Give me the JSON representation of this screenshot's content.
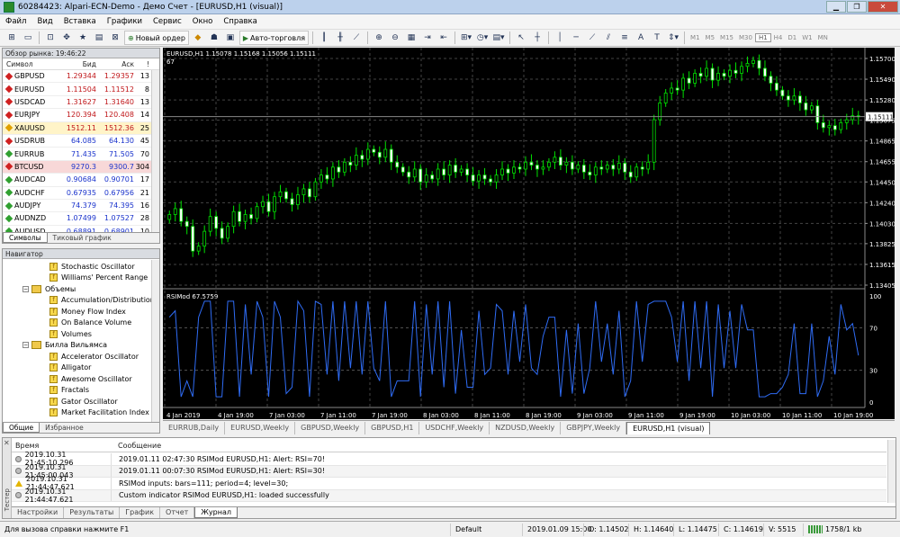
{
  "window": {
    "title": "60284423: Alpari-ECN-Demo - Демо Счет - [EURUSD,H1 (visual)]"
  },
  "menu": [
    "Файл",
    "Вид",
    "Вставка",
    "Графики",
    "Сервис",
    "Окно",
    "Справка"
  ],
  "toolbar": {
    "new_order": "Новый ордер",
    "autotrading": "Авто-торговля",
    "timeframes": [
      "M1",
      "M5",
      "M15",
      "M30",
      "H1",
      "H4",
      "D1",
      "W1",
      "MN"
    ],
    "current_tf": "H1"
  },
  "market_watch": {
    "title": "Обзор рынка: 19:46:22",
    "columns": {
      "symbol": "Символ",
      "bid": "Бид",
      "ask": "Аск",
      "spread": "!"
    },
    "rows": [
      {
        "symbol": "GBPUSD",
        "bid": "1.29344",
        "ask": "1.29357",
        "spread": "13",
        "dir": "down",
        "icon_color": "#d02020"
      },
      {
        "symbol": "EURUSD",
        "bid": "1.11504",
        "ask": "1.11512",
        "spread": "8",
        "dir": "down",
        "icon_color": "#d02020"
      },
      {
        "symbol": "USDCAD",
        "bid": "1.31627",
        "ask": "1.31640",
        "spread": "13",
        "dir": "down",
        "icon_color": "#d02020"
      },
      {
        "symbol": "EURJPY",
        "bid": "120.394",
        "ask": "120.408",
        "spread": "14",
        "dir": "down",
        "icon_color": "#d02020"
      },
      {
        "symbol": "XAUUSD",
        "bid": "1512.11",
        "ask": "1512.36",
        "spread": "25",
        "dir": "down",
        "icon_color": "#e0a000",
        "highlight": "#fff4c8"
      },
      {
        "symbol": "USDRUB",
        "bid": "64.085",
        "ask": "64.130",
        "spread": "45",
        "dir": "up",
        "icon_color": "#d02020"
      },
      {
        "symbol": "EURRUB",
        "bid": "71.435",
        "ask": "71.505",
        "spread": "70",
        "dir": "up",
        "icon_color": "#30a030"
      },
      {
        "symbol": "BTCUSD",
        "bid": "9270.3",
        "ask": "9300.7",
        "spread": "304",
        "dir": "up",
        "icon_color": "#d02020",
        "highlight": "#f8d8d8"
      },
      {
        "symbol": "AUDCAD",
        "bid": "0.90684",
        "ask": "0.90701",
        "spread": "17",
        "dir": "up",
        "icon_color": "#30a030"
      },
      {
        "symbol": "AUDCHF",
        "bid": "0.67935",
        "ask": "0.67956",
        "spread": "21",
        "dir": "up",
        "icon_color": "#30a030"
      },
      {
        "symbol": "AUDJPY",
        "bid": "74.379",
        "ask": "74.395",
        "spread": "16",
        "dir": "up",
        "icon_color": "#30a030"
      },
      {
        "symbol": "AUDNZD",
        "bid": "1.07499",
        "ask": "1.07527",
        "spread": "28",
        "dir": "up",
        "icon_color": "#30a030"
      },
      {
        "symbol": "AUDUSD",
        "bid": "0.68891",
        "ask": "0.68901",
        "spread": "10",
        "dir": "up",
        "icon_color": "#30a030"
      }
    ],
    "tabs": [
      "Символы",
      "Тиковый график"
    ]
  },
  "navigator": {
    "title": "Навигатор",
    "items": [
      {
        "label": "Stochastic Oscillator",
        "level": 2,
        "kind": "ind"
      },
      {
        "label": "Williams' Percent Range",
        "level": 2,
        "kind": "ind"
      },
      {
        "label": "Объемы",
        "level": 1,
        "kind": "folder"
      },
      {
        "label": "Accumulation/Distribution",
        "level": 2,
        "kind": "ind"
      },
      {
        "label": "Money Flow Index",
        "level": 2,
        "kind": "ind"
      },
      {
        "label": "On Balance Volume",
        "level": 2,
        "kind": "ind"
      },
      {
        "label": "Volumes",
        "level": 2,
        "kind": "ind"
      },
      {
        "label": "Билла Вильямса",
        "level": 1,
        "kind": "folder"
      },
      {
        "label": "Accelerator Oscillator",
        "level": 2,
        "kind": "ind"
      },
      {
        "label": "Alligator",
        "level": 2,
        "kind": "ind"
      },
      {
        "label": "Awesome Oscillator",
        "level": 2,
        "kind": "ind"
      },
      {
        "label": "Fractals",
        "level": 2,
        "kind": "ind"
      },
      {
        "label": "Gator Oscillator",
        "level": 2,
        "kind": "ind"
      },
      {
        "label": "Market Facilitation Index",
        "level": 2,
        "kind": "ind"
      }
    ],
    "tabs": [
      "Общие",
      "Избранное"
    ]
  },
  "chart": {
    "info": "EURUSD,H1  1.15078 1.15168 1.15056 1.15111",
    "info2": "67",
    "rsi_label": "RSIMod 67.5759",
    "current_price": "1.15111",
    "price_labels": [
      "1.15700",
      "1.15490",
      "1.15280",
      "1.15075",
      "1.14865",
      "1.14655",
      "1.14450",
      "1.14240",
      "1.14030",
      "1.13825",
      "1.13615",
      "1.13405"
    ],
    "rsi_labels": [
      "100",
      "70",
      "30",
      "0"
    ],
    "time_labels": [
      "4 Jan 2019",
      "4 Jan 19:00",
      "7 Jan 03:00",
      "7 Jan 11:00",
      "7 Jan 19:00",
      "8 Jan 03:00",
      "8 Jan 11:00",
      "8 Jan 19:00",
      "9 Jan 03:00",
      "9 Jan 11:00",
      "9 Jan 19:00",
      "10 Jan 03:00",
      "10 Jan 11:00",
      "10 Jan 19:00"
    ]
  },
  "chart_data": {
    "type": "candlestick",
    "symbol": "EURUSD",
    "timeframe": "H1",
    "ylim": [
      1.13405,
      1.157
    ],
    "rsi": {
      "ylim": [
        0,
        100
      ],
      "levels": [
        70,
        30
      ]
    },
    "close": [
      1.1412,
      1.1418,
      1.1405,
      1.14,
      1.1375,
      1.138,
      1.1395,
      1.141,
      1.1398,
      1.1388,
      1.14,
      1.1415,
      1.1405,
      1.1412,
      1.1408,
      1.142,
      1.1425,
      1.1415,
      1.143,
      1.1435,
      1.1428,
      1.1422,
      1.1432,
      1.1438,
      1.143,
      1.1445,
      1.1452,
      1.1448,
      1.146,
      1.1455,
      1.1465,
      1.1462,
      1.1472,
      1.1468,
      1.1478,
      1.1475,
      1.147,
      1.1478,
      1.1465,
      1.146,
      1.1455,
      1.145,
      1.1458,
      1.1445,
      1.1452,
      1.1448,
      1.1458,
      1.1452,
      1.1462,
      1.1455,
      1.1458,
      1.1452,
      1.1446,
      1.1452,
      1.1448,
      1.1445,
      1.1452,
      1.1458,
      1.1454,
      1.146,
      1.1458,
      1.1465,
      1.1462,
      1.1458,
      1.146,
      1.1465,
      1.147,
      1.1462,
      1.1465,
      1.1458,
      1.1462,
      1.1455,
      1.1452,
      1.146,
      1.1458,
      1.1462,
      1.1458,
      1.1464,
      1.1455,
      1.145,
      1.146,
      1.1458,
      1.1465,
      1.1508,
      1.1525,
      1.1535,
      1.154,
      1.1538,
      1.155,
      1.1545,
      1.1555,
      1.1552,
      1.156,
      1.1548,
      1.1555,
      1.1552,
      1.1558,
      1.1555,
      1.1562,
      1.1565,
      1.1568,
      1.156,
      1.1552,
      1.1545,
      1.1538,
      1.1532,
      1.1528,
      1.1532,
      1.1525,
      1.1518,
      1.1522,
      1.1505,
      1.15,
      1.1502,
      1.1498,
      1.1505,
      1.1508,
      1.1512,
      1.1511
    ]
  },
  "chart_tabs": [
    "EURRUB,Daily",
    "EURUSD,Weekly",
    "GBPUSD,Weekly",
    "GBPUSD,H1",
    "USDCHF,Weekly",
    "NZDUSD,Weekly",
    "GBPJPY,Weekly",
    "EURUSD,H1 (visual)"
  ],
  "terminal": {
    "side_label": "Тестер",
    "columns": {
      "time": "Время",
      "message": "Сообщение"
    },
    "rows": [
      {
        "time": "2019.10.31 21:45:10.296",
        "message": "2019.01.11 02:47:30  RSIMod EURUSD,H1: Alert: RSI=70!",
        "icon": "info"
      },
      {
        "time": "2019.10.31 21:45:00.043",
        "message": "2019.01.11 00:07:30  RSIMod EURUSD,H1: Alert: RSI=30!",
        "icon": "info"
      },
      {
        "time": "2019.10.31 21:44:47.621",
        "message": "RSIMod inputs: bars=111; period=4; level=30;",
        "icon": "warn"
      },
      {
        "time": "2019.10.31 21:44:47.621",
        "message": "Custom indicator RSIMod EURUSD,H1: loaded successfully",
        "icon": "info"
      }
    ],
    "tabs": [
      "Настройки",
      "Результаты",
      "График",
      "Отчет",
      "Журнал"
    ]
  },
  "status": {
    "help": "Для вызова справки нажмите F1",
    "profile": "Default",
    "datetime": "2019.01.09 15:00",
    "open": "O: 1.14502",
    "high": "H: 1.14640",
    "low": "L: 1.14475",
    "close": "C: 1.14619",
    "volume": "V: 5515",
    "traffic": "1758/1 kb"
  }
}
